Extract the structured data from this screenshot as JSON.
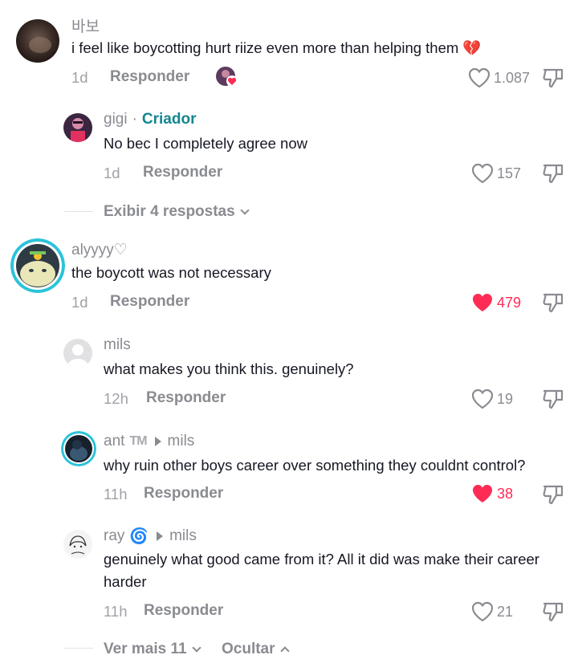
{
  "comments": [
    {
      "username": "바보",
      "text": "i feel like boycotting hurt riize even more than helping them 💔",
      "time": "1d",
      "reply_label": "Responder",
      "likes": "1.087"
    },
    {
      "username": "gigi",
      "separator": "·",
      "badge": "Criador",
      "text": "No bec I completely agree now",
      "time": "1d",
      "reply_label": "Responder",
      "likes": "157"
    },
    {
      "username": "alyyyy♡",
      "text": "the boycott was not necessary",
      "time": "1d",
      "reply_label": "Responder",
      "likes": "479"
    },
    {
      "username": "mils",
      "text": "what makes you think this. genuinely?",
      "time": "12h",
      "reply_label": "Responder",
      "likes": "19"
    },
    {
      "username": "ant",
      "badge": "TM",
      "reply_to": "mils",
      "text": "why ruin other boys career over something they couldnt control?",
      "time": "11h",
      "reply_label": "Responder",
      "likes": "38"
    },
    {
      "username": "ray",
      "badge": "🌀",
      "reply_to": "mils",
      "text_line1": "genuinely what good came from it? All it did was make their career",
      "text_line2": "harder",
      "time": "11h",
      "reply_label": "Responder",
      "likes": "21"
    }
  ],
  "view_replies_label": "Exibir 4 respostas",
  "see_more_label": "Ver mais 11",
  "hide_label": "Ocultar",
  "colors": {
    "liked": "#fe2c55",
    "creator": "#13868f",
    "muted": "#8a8b91"
  }
}
